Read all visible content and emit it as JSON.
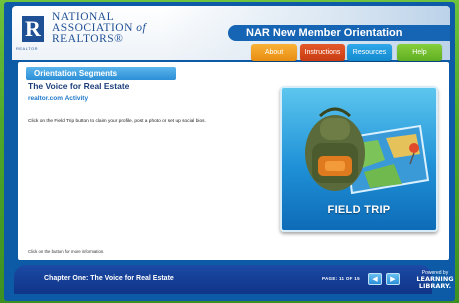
{
  "logo": {
    "mark": "R",
    "small_label": "REALTOR",
    "line1": "NATIONAL",
    "line2": "ASSOCIATION",
    "line2_of": "of",
    "line3": "REALTORS®"
  },
  "app_title": "NAR New Member Orientation",
  "nav": {
    "about": "About",
    "instructions": "Instructions",
    "resources": "Resources",
    "help": "Help"
  },
  "content": {
    "segments_label": "Orientation Segments",
    "section_title": "The Voice for Real Estate",
    "activity_title": "realtor.com Activity",
    "instructions_text": "Click on the Field Trip button to claim your profile, post a photo or set up social bios.",
    "footer_note": "Click on the button for more information.",
    "field_trip_label": "FIELD TRIP"
  },
  "footer": {
    "chapter": "Chapter One: The Voice for Real Estate",
    "page_label": "PAGE: 11 OF 15",
    "prev_icon": "left-arrow-icon",
    "next_icon": "right-arrow-icon",
    "powered_line1": "Powered by",
    "powered_line2": "LEARNING",
    "powered_line3": "LIBRARY."
  },
  "colors": {
    "frame": "#0d5aa7",
    "accent_green": "#4fa82a",
    "about": "#f0a024",
    "instructions": "#d6481c",
    "resources": "#1e98de",
    "help": "#6fbf2e"
  }
}
